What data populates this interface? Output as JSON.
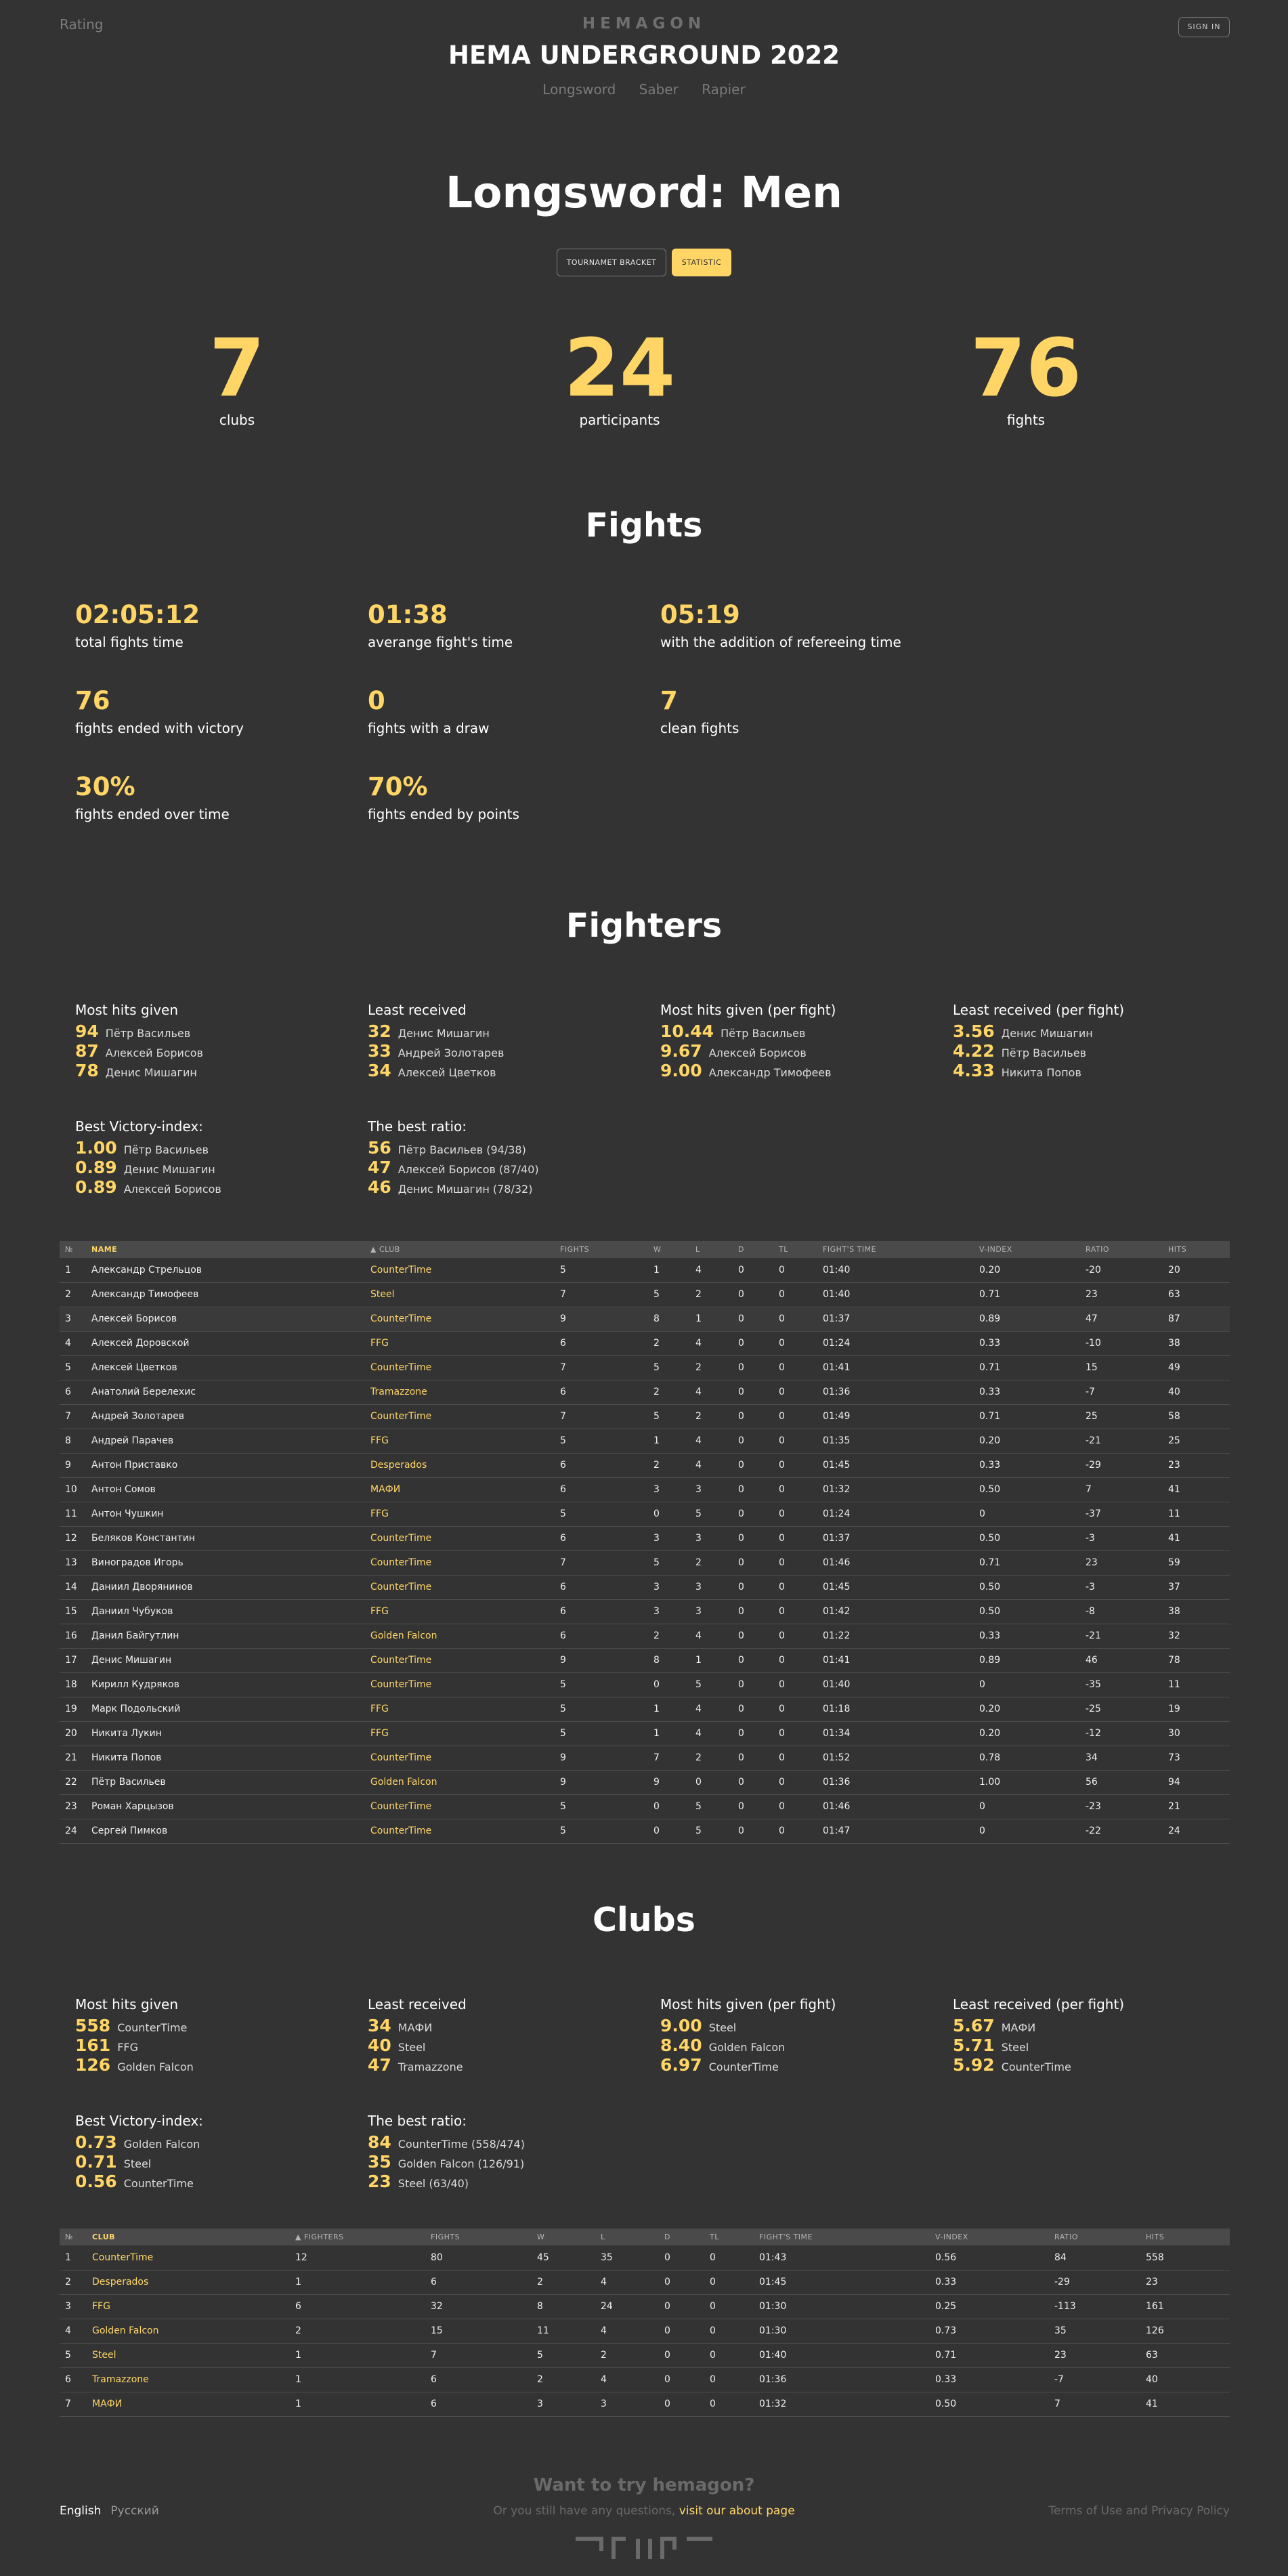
{
  "header": {
    "rating": "Rating",
    "brand": "HEMAGON",
    "event": "HEMA UNDERGROUND 2022",
    "nav": [
      "Longsword",
      "Saber",
      "Rapier"
    ],
    "signin": "SIGN IN"
  },
  "page": {
    "title": "Longsword: Men",
    "tabs": [
      "TOURNAMET BRACKET",
      "STATISTIC"
    ]
  },
  "summary": [
    {
      "value": "7",
      "label": "clubs"
    },
    {
      "value": "24",
      "label": "participants"
    },
    {
      "value": "76",
      "label": "fights"
    }
  ],
  "fights": {
    "title": "Fights",
    "stats": [
      {
        "value": "02:05:12",
        "label": "total fights time"
      },
      {
        "value": "01:38",
        "label": "averange fight's time"
      },
      {
        "value": "05:19",
        "label": "with the addition of refereeing time"
      },
      {
        "value": "76",
        "label": "fights ended with victory"
      },
      {
        "value": "0",
        "label": "fights with a draw"
      },
      {
        "value": "7",
        "label": "clean fights"
      },
      {
        "value": "30%",
        "label": "fights ended over time"
      },
      {
        "value": "70%",
        "label": "fights ended by points"
      }
    ]
  },
  "fighters": {
    "title": "Fighters",
    "leaders": [
      {
        "title": "Most hits given",
        "rows": [
          [
            "94",
            "Пётр Васильев"
          ],
          [
            "87",
            "Алексей Борисов"
          ],
          [
            "78",
            "Денис Мишагин"
          ]
        ]
      },
      {
        "title": "Least received",
        "rows": [
          [
            "32",
            "Денис Мишагин"
          ],
          [
            "33",
            "Андрей Золотарев"
          ],
          [
            "34",
            "Алексей Цветков"
          ]
        ]
      },
      {
        "title": "Most hits given (per fight)",
        "rows": [
          [
            "10.44",
            "Пётр Васильев"
          ],
          [
            "9.67",
            "Алексей Борисов"
          ],
          [
            "9.00",
            "Александр Тимофеев"
          ]
        ]
      },
      {
        "title": "Least received (per fight)",
        "rows": [
          [
            "3.56",
            "Денис Мишагин"
          ],
          [
            "4.22",
            "Пётр Васильев"
          ],
          [
            "4.33",
            "Никита Попов"
          ]
        ]
      },
      {
        "title": "Best Victory-index:",
        "rows": [
          [
            "1.00",
            "Пётр Васильев"
          ],
          [
            "0.89",
            "Денис Мишагин"
          ],
          [
            "0.89",
            "Алексей Борисов"
          ]
        ]
      },
      {
        "title": "The best ratio:",
        "rows": [
          [
            "56",
            "Пётр Васильев (94/38)"
          ],
          [
            "47",
            "Алексей Борисов (87/40)"
          ],
          [
            "46",
            "Денис Мишагин (78/32)"
          ]
        ]
      }
    ],
    "table": {
      "headers": [
        "№",
        "NAME",
        "CLUB",
        "FIGHTS",
        "W",
        "L",
        "D",
        "TL",
        "FIGHT'S TIME",
        "V-INDEX",
        "RATIO",
        "HITS"
      ],
      "rows": [
        [
          "1",
          "Александр Стрельцов",
          "CounterTime",
          "5",
          "1",
          "4",
          "0",
          "0",
          "01:40",
          "0.20",
          "-20",
          "20"
        ],
        [
          "2",
          "Александр Тимофеев",
          "Steel",
          "7",
          "5",
          "2",
          "0",
          "0",
          "01:40",
          "0.71",
          "23",
          "63"
        ],
        [
          "3",
          "Алексей Борисов",
          "CounterTime",
          "9",
          "8",
          "1",
          "0",
          "0",
          "01:37",
          "0.89",
          "47",
          "87"
        ],
        [
          "4",
          "Алексей Доровской",
          "FFG",
          "6",
          "2",
          "4",
          "0",
          "0",
          "01:24",
          "0.33",
          "-10",
          "38"
        ],
        [
          "5",
          "Алексей Цветков",
          "CounterTime",
          "7",
          "5",
          "2",
          "0",
          "0",
          "01:41",
          "0.71",
          "15",
          "49"
        ],
        [
          "6",
          "Анатолий Берелехис",
          "Tramazzone",
          "6",
          "2",
          "4",
          "0",
          "0",
          "01:36",
          "0.33",
          "-7",
          "40"
        ],
        [
          "7",
          "Андрей Золотарев",
          "CounterTime",
          "7",
          "5",
          "2",
          "0",
          "0",
          "01:49",
          "0.71",
          "25",
          "58"
        ],
        [
          "8",
          "Андрей Парачев",
          "FFG",
          "5",
          "1",
          "4",
          "0",
          "0",
          "01:35",
          "0.20",
          "-21",
          "25"
        ],
        [
          "9",
          "Антон Приставко",
          "Desperados",
          "6",
          "2",
          "4",
          "0",
          "0",
          "01:45",
          "0.33",
          "-29",
          "23"
        ],
        [
          "10",
          "Антон Сомов",
          "МАФИ",
          "6",
          "3",
          "3",
          "0",
          "0",
          "01:32",
          "0.50",
          "7",
          "41"
        ],
        [
          "11",
          "Антон Чушкин",
          "FFG",
          "5",
          "0",
          "5",
          "0",
          "0",
          "01:24",
          "0",
          "-37",
          "11"
        ],
        [
          "12",
          "Беляков Константин",
          "CounterTime",
          "6",
          "3",
          "3",
          "0",
          "0",
          "01:37",
          "0.50",
          "-3",
          "41"
        ],
        [
          "13",
          "Виноградов Игорь",
          "CounterTime",
          "7",
          "5",
          "2",
          "0",
          "0",
          "01:46",
          "0.71",
          "23",
          "59"
        ],
        [
          "14",
          "Даниил Дворянинов",
          "CounterTime",
          "6",
          "3",
          "3",
          "0",
          "0",
          "01:45",
          "0.50",
          "-3",
          "37"
        ],
        [
          "15",
          "Даниил Чубуков",
          "FFG",
          "6",
          "3",
          "3",
          "0",
          "0",
          "01:42",
          "0.50",
          "-8",
          "38"
        ],
        [
          "16",
          "Данил Байгутлин",
          "Golden Falcon",
          "6",
          "2",
          "4",
          "0",
          "0",
          "01:22",
          "0.33",
          "-21",
          "32"
        ],
        [
          "17",
          "Денис Мишагин",
          "CounterTime",
          "9",
          "8",
          "1",
          "0",
          "0",
          "01:41",
          "0.89",
          "46",
          "78"
        ],
        [
          "18",
          "Кирилл Кудряков",
          "CounterTime",
          "5",
          "0",
          "5",
          "0",
          "0",
          "01:40",
          "0",
          "-35",
          "11"
        ],
        [
          "19",
          "Марк Подольский",
          "FFG",
          "5",
          "1",
          "4",
          "0",
          "0",
          "01:18",
          "0.20",
          "-25",
          "19"
        ],
        [
          "20",
          "Никита Лукин",
          "FFG",
          "5",
          "1",
          "4",
          "0",
          "0",
          "01:34",
          "0.20",
          "-12",
          "30"
        ],
        [
          "21",
          "Никита Попов",
          "CounterTime",
          "9",
          "7",
          "2",
          "0",
          "0",
          "01:52",
          "0.78",
          "34",
          "73"
        ],
        [
          "22",
          "Пётр Васильев",
          "Golden Falcon",
          "9",
          "9",
          "0",
          "0",
          "0",
          "01:36",
          "1.00",
          "56",
          "94"
        ],
        [
          "23",
          "Роман Харцызов",
          "CounterTime",
          "5",
          "0",
          "5",
          "0",
          "0",
          "01:46",
          "0",
          "-23",
          "21"
        ],
        [
          "24",
          "Сергей Пимков",
          "CounterTime",
          "5",
          "0",
          "5",
          "0",
          "0",
          "01:47",
          "0",
          "-22",
          "24"
        ]
      ]
    }
  },
  "clubs": {
    "title": "Clubs",
    "leaders": [
      {
        "title": "Most hits given",
        "rows": [
          [
            "558",
            "CounterTime"
          ],
          [
            "161",
            "FFG"
          ],
          [
            "126",
            "Golden Falcon"
          ]
        ]
      },
      {
        "title": "Least received",
        "rows": [
          [
            "34",
            "МАФИ"
          ],
          [
            "40",
            "Steel"
          ],
          [
            "47",
            "Tramazzone"
          ]
        ]
      },
      {
        "title": "Most hits given (per fight)",
        "rows": [
          [
            "9.00",
            "Steel"
          ],
          [
            "8.40",
            "Golden Falcon"
          ],
          [
            "6.97",
            "CounterTime"
          ]
        ]
      },
      {
        "title": "Least received (per fight)",
        "rows": [
          [
            "5.67",
            "МАФИ"
          ],
          [
            "5.71",
            "Steel"
          ],
          [
            "5.92",
            "CounterTime"
          ]
        ]
      },
      {
        "title": "Best Victory-index:",
        "rows": [
          [
            "0.73",
            "Golden Falcon"
          ],
          [
            "0.71",
            "Steel"
          ],
          [
            "0.56",
            "CounterTime"
          ]
        ]
      },
      {
        "title": "The best ratio:",
        "rows": [
          [
            "84",
            "CounterTime (558/474)"
          ],
          [
            "35",
            "Golden Falcon (126/91)"
          ],
          [
            "23",
            "Steel (63/40)"
          ]
        ]
      }
    ],
    "table": {
      "headers": [
        "№",
        "CLUB",
        "FIGHTERS",
        "FIGHTS",
        "W",
        "L",
        "D",
        "TL",
        "FIGHT'S TIME",
        "V-INDEX",
        "RATIO",
        "HITS"
      ],
      "rows": [
        [
          "1",
          "CounterTime",
          "12",
          "80",
          "45",
          "35",
          "0",
          "0",
          "01:43",
          "0.56",
          "84",
          "558"
        ],
        [
          "2",
          "Desperados",
          "1",
          "6",
          "2",
          "4",
          "0",
          "0",
          "01:45",
          "0.33",
          "-29",
          "23"
        ],
        [
          "3",
          "FFG",
          "6",
          "32",
          "8",
          "24",
          "0",
          "0",
          "01:30",
          "0.25",
          "-113",
          "161"
        ],
        [
          "4",
          "Golden Falcon",
          "2",
          "15",
          "11",
          "4",
          "0",
          "0",
          "01:30",
          "0.73",
          "35",
          "126"
        ],
        [
          "5",
          "Steel",
          "1",
          "7",
          "5",
          "2",
          "0",
          "0",
          "01:40",
          "0.71",
          "23",
          "63"
        ],
        [
          "6",
          "Tramazzone",
          "1",
          "6",
          "2",
          "4",
          "0",
          "0",
          "01:36",
          "0.33",
          "-7",
          "40"
        ],
        [
          "7",
          "МАФИ",
          "1",
          "6",
          "3",
          "3",
          "0",
          "0",
          "01:32",
          "0.50",
          "7",
          "41"
        ]
      ]
    }
  },
  "footer": {
    "want": "Want to try hemagon?",
    "ask": "Or you still have any questions,",
    "ask_link": "visit our about page",
    "langs": [
      "English",
      "Русский"
    ],
    "terms": "Terms of Use and Privacy Policy"
  }
}
